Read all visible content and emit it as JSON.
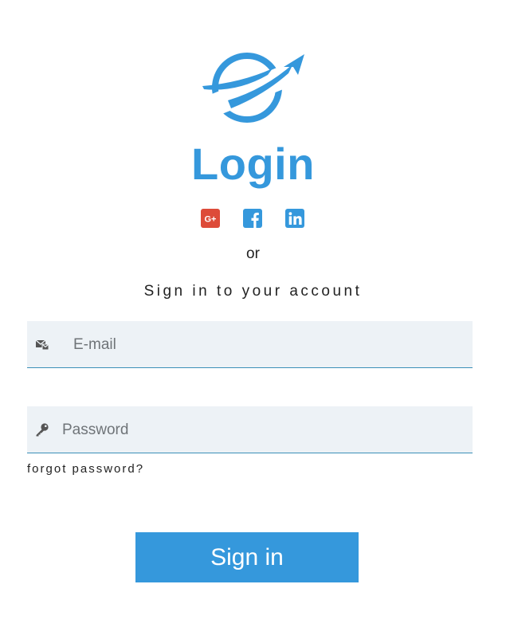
{
  "header": {
    "title": "Login"
  },
  "social": {
    "items": [
      {
        "name": "google-plus",
        "label": "G+",
        "color": "#dd4b39"
      },
      {
        "name": "facebook",
        "label": "f",
        "color": "#3598dc"
      },
      {
        "name": "linkedin",
        "label": "in",
        "color": "#3598dc"
      }
    ]
  },
  "divider_text": "or",
  "subtitle": "Sign in to your account",
  "form": {
    "email": {
      "placeholder": "E-mail",
      "value": "",
      "icon": "email-icon"
    },
    "password": {
      "placeholder": "Password",
      "value": "",
      "icon": "key-icon"
    },
    "forgot_link": "forgot password?",
    "submit_label": "Sign in"
  },
  "colors": {
    "accent": "#3598dc",
    "google": "#dd4b39",
    "field_bg": "#edf2f6",
    "field_border": "#3b8fb8"
  }
}
